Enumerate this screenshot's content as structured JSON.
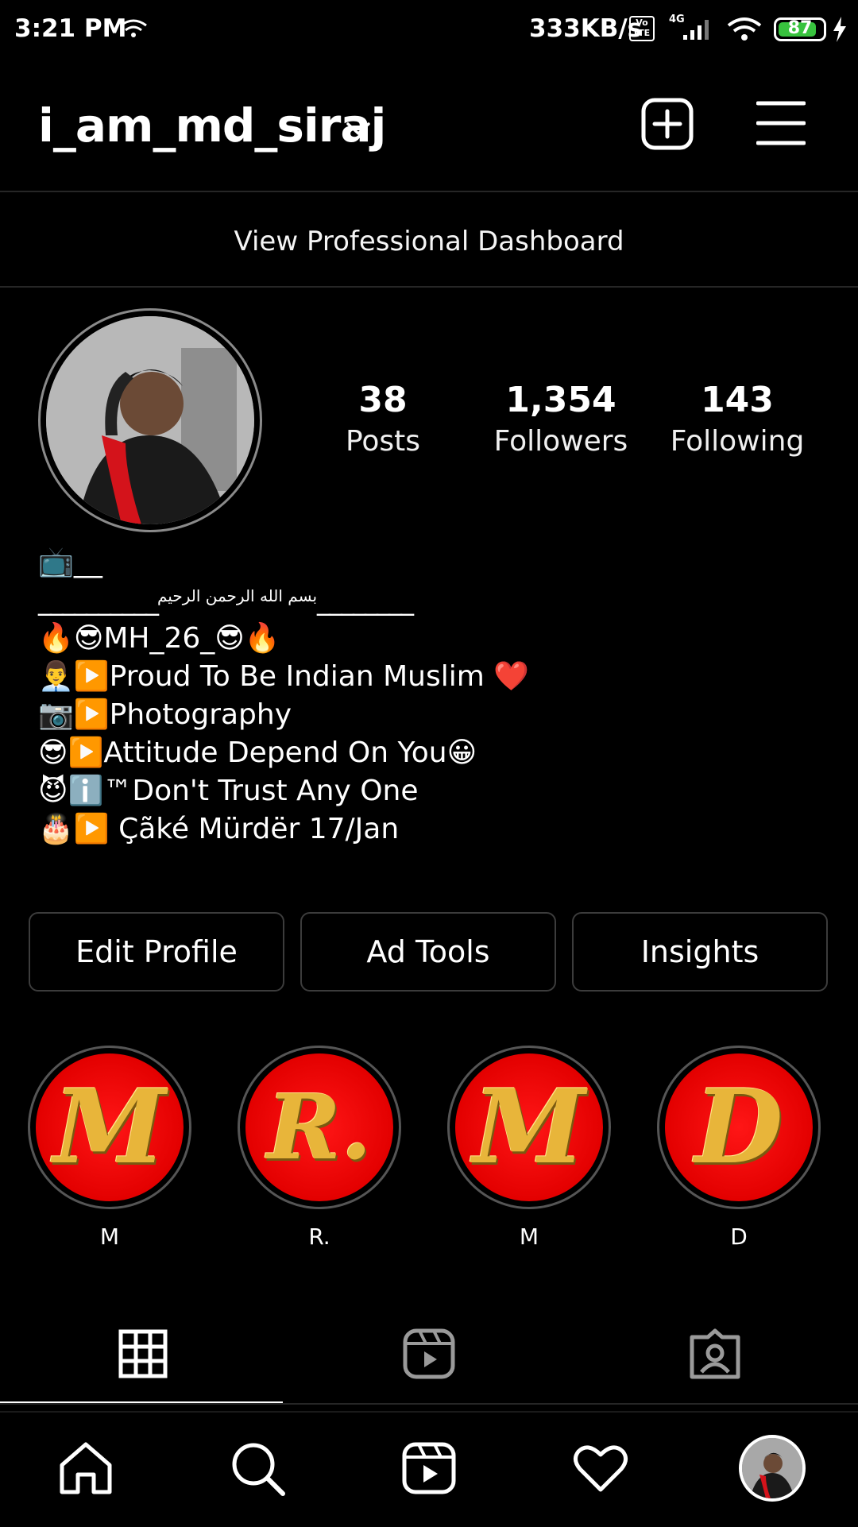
{
  "status_bar": {
    "time": "3:21 PM",
    "net_speed": "333KB/s",
    "volte": "Vo LTE",
    "network": "4G",
    "battery": "87",
    "battery_level": 0.87,
    "battery_color": "#38c23e"
  },
  "header": {
    "username": "i_am_md_siraj",
    "icons": [
      "chevron-down-icon",
      "create-plus-icon",
      "hamburger-menu-icon"
    ]
  },
  "dashboard": {
    "label": "View Professional Dashboard"
  },
  "stats": [
    {
      "value": "38",
      "label": "Posts"
    },
    {
      "value": "1,354",
      "label": "Followers"
    },
    {
      "value": "143",
      "label": "Following"
    }
  ],
  "bio": {
    "line0": "📺__",
    "sep_left": "__________",
    "arabic": "بسم الله الرحمن الرحيم",
    "sep_right": "________",
    "lines": [
      "🔥😎MH_26_😎🔥",
      "👨‍💼▶️Proud To Be Indian Muslim ❤️",
      "📷▶️Photography",
      "😎▶️Attitude Depend On You😀",
      "😈ℹ️™Don't Trust Any One",
      "🎂▶️ Çãké Mürdër 17/Jan"
    ]
  },
  "buttons": {
    "edit_profile": "Edit Profile",
    "ad_tools": "Ad Tools",
    "insights": "Insights"
  },
  "highlights": [
    {
      "letter": "M",
      "label": "M"
    },
    {
      "letter": "R.",
      "label": "R."
    },
    {
      "letter": "M",
      "label": "M"
    },
    {
      "letter": "D",
      "label": "D"
    }
  ],
  "tabs": [
    "grid-icon",
    "reels-icon",
    "tagged-icon"
  ],
  "bottom_nav": [
    "home-icon",
    "search-icon",
    "reels-icon",
    "heart-icon",
    "profile-avatar"
  ],
  "colors": {
    "background": "#000000",
    "highlight_red": "#e30000",
    "highlight_gold": "#e8b53a",
    "divider": "#262626"
  }
}
